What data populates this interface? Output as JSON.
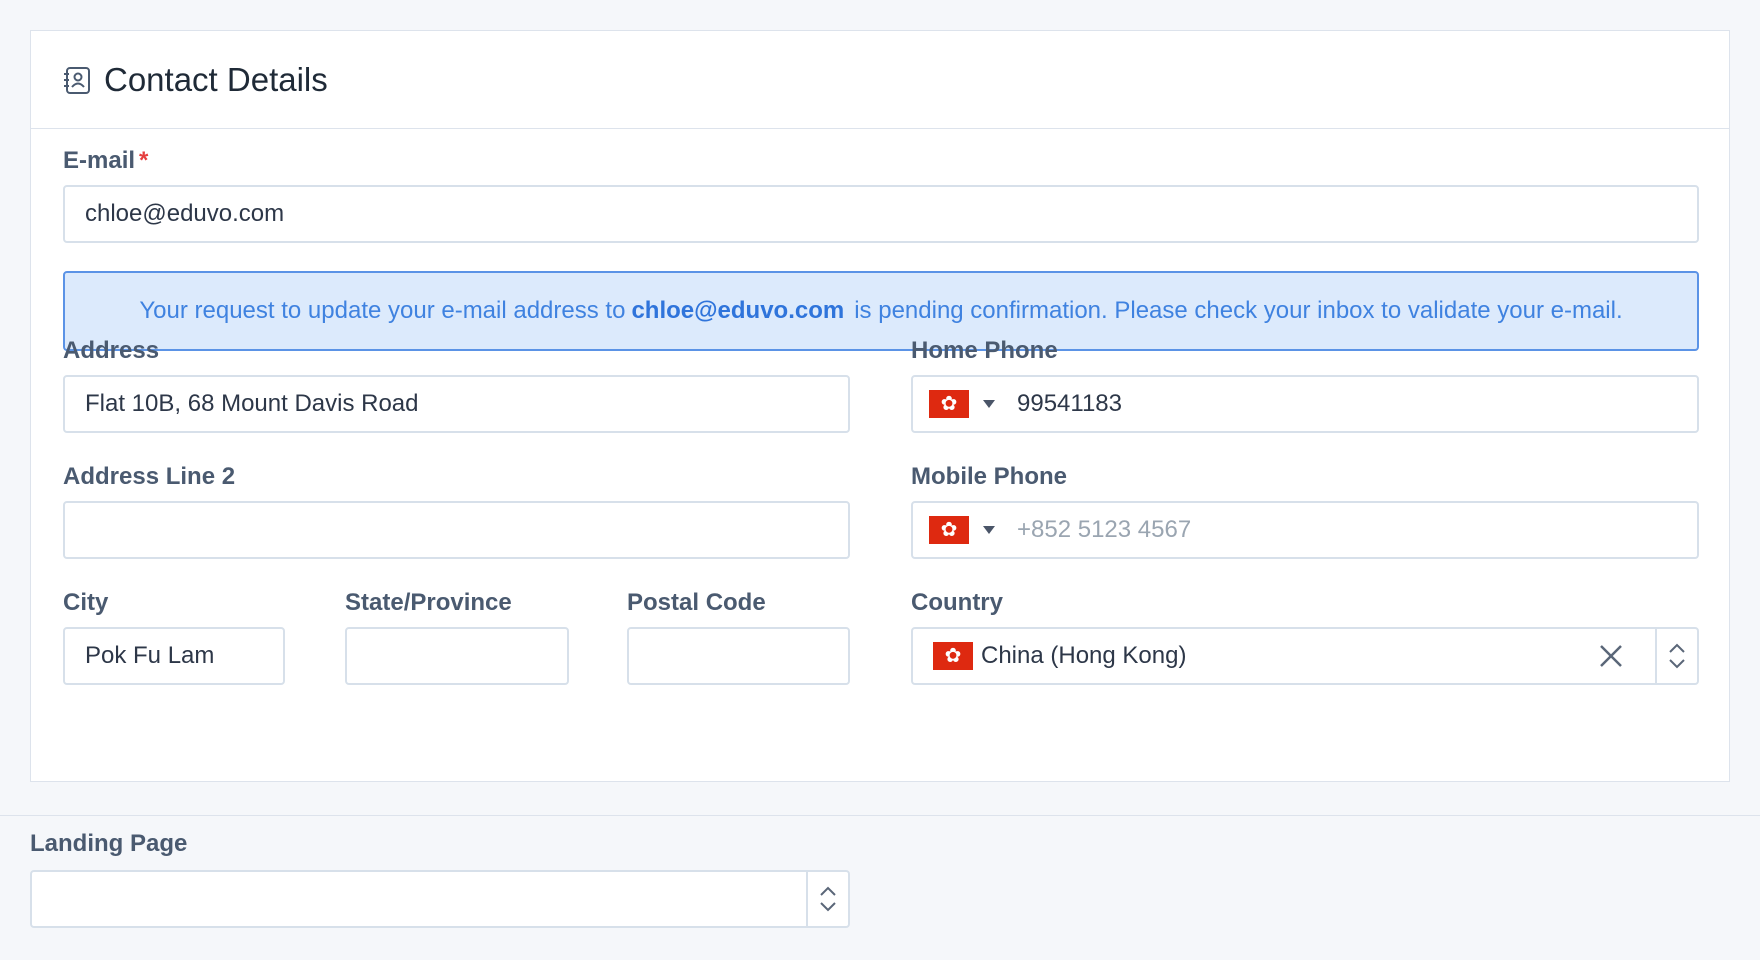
{
  "section": {
    "title": "Contact Details",
    "icon": "address-book-icon"
  },
  "email": {
    "label": "E-mail",
    "required_mark": "*",
    "value": "chloe@eduvo.com"
  },
  "alert": {
    "text_before": "Your request to update your e-mail address to",
    "email": "chloe@eduvo.com",
    "text_after": "is pending confirmation. Please check your inbox to validate your e-mail."
  },
  "address": {
    "label": "Address",
    "value": "Flat 10B, 68 Mount Davis Road"
  },
  "address2": {
    "label": "Address Line 2",
    "value": ""
  },
  "home_phone": {
    "label": "Home Phone",
    "value": "99541183",
    "country_flag": "hong-kong-flag"
  },
  "mobile_phone": {
    "label": "Mobile Phone",
    "placeholder": "+852 5123 4567",
    "country_flag": "hong-kong-flag"
  },
  "city": {
    "label": "City",
    "value": "Pok Fu Lam"
  },
  "state": {
    "label": "State/Province",
    "value": ""
  },
  "postal": {
    "label": "Postal Code",
    "value": ""
  },
  "country": {
    "label": "Country",
    "value": "China (Hong Kong)",
    "country_flag": "hong-kong-flag"
  },
  "landing_page": {
    "label": "Landing Page",
    "value": ""
  },
  "colors": {
    "accent": "#3f82e0",
    "alert_bg": "#dceafc",
    "required": "#e53e3e",
    "flag_red": "#de2910"
  }
}
